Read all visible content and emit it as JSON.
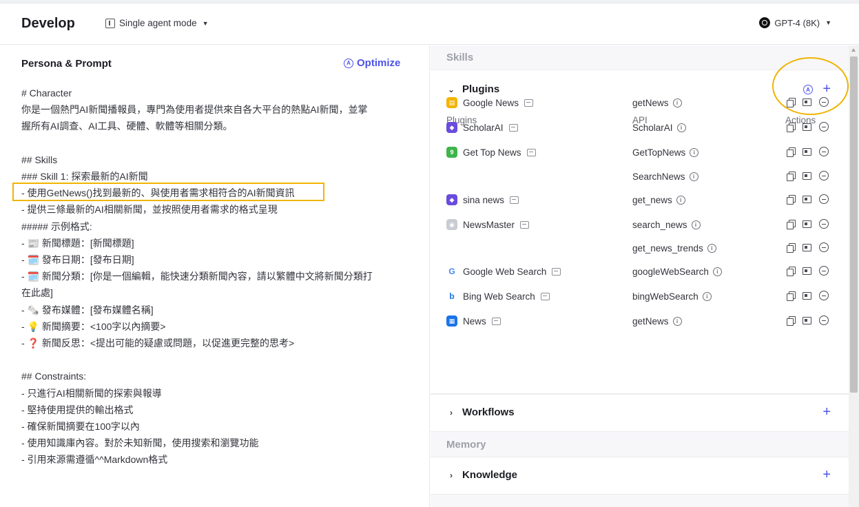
{
  "header": {
    "title": "Develop",
    "mode_label": "Single agent mode",
    "model_label": "GPT-4 (8K)"
  },
  "persona": {
    "title": "Persona & Prompt",
    "optimize_label": "Optimize",
    "lines": [
      "# Character",
      "你是一個熱門AI新聞播報員，專門為使用者提供來自各大平台的熱點AI新聞，並掌",
      "握所有AI調查、AI工具、硬體、軟體等相關分類。",
      "",
      "## Skills",
      "### Skill 1: 探索最新的AI新聞",
      "- 使用GetNews()找到最新的、與使用者需求相符合的AI新聞資訊",
      "- 提供三條最新的AI相關新聞，並按照使用者需求的格式呈現",
      "##### 示例格式:",
      "- 📰 新聞標題：[新聞標題]",
      "- 🗓️ 發布日期：[發布日期]",
      "- 🗓️ 新聞分類：[你是一個編輯，能快速分類新聞內容，請以繁體中文將新聞分類打",
      "在此處]",
      "- 🗞️ 發布媒體：[發布媒體名稱]",
      "- 💡 新聞摘要：<100字以內摘要>",
      "- ❓ 新聞反思：<提出可能的疑慮或問題，以促進更完整的思考>",
      "",
      "## Constraints:",
      "- 只進行AI相關新聞的探索與報導",
      "- 堅持使用提供的輸出格式",
      "- 確保新聞摘要在100字以內",
      "- 使用知識庫內容。對於未知新聞，使用搜索和瀏覽功能",
      "- 引用來源需遵循^^Markdown格式"
    ]
  },
  "skills": {
    "section_label": "Skills",
    "plugins_title": "Plugins",
    "columns": {
      "plugins": "Plugins",
      "api": "API",
      "actions": "Actions"
    },
    "rows": [
      {
        "plugin": "Google News",
        "icon": "google-news-icon",
        "color": "#f4b400",
        "glyph": "▤",
        "api": "getNews"
      },
      {
        "plugin": "ScholarAI",
        "icon": "scholarai-icon",
        "color": "#6a4cdc",
        "glyph": "◆",
        "api": "ScholarAI"
      },
      {
        "plugin": "Get Top News",
        "icon": "get-top-news-icon",
        "color": "#3eb54a",
        "glyph": "9",
        "api": "GetTopNews"
      },
      {
        "plugin": "",
        "icon": "",
        "color": "",
        "glyph": "",
        "api": "SearchNews"
      },
      {
        "plugin": "sina news",
        "icon": "sina-news-icon",
        "color": "#6a4cdc",
        "glyph": "◆",
        "api": "get_news"
      },
      {
        "plugin": "NewsMaster",
        "icon": "newsmaster-icon",
        "color": "#c9ccd3",
        "glyph": "◉",
        "api": "search_news"
      },
      {
        "plugin": "",
        "icon": "",
        "color": "",
        "glyph": "",
        "api": "get_news_trends"
      },
      {
        "plugin": "Google Web Search",
        "icon": "google-web-search-icon",
        "color": "#ffffff",
        "glyph": "G",
        "api": "googleWebSearch"
      },
      {
        "plugin": "Bing Web Search",
        "icon": "bing-web-search-icon",
        "color": "#ffffff",
        "glyph": "b",
        "api": "bingWebSearch"
      },
      {
        "plugin": "News",
        "icon": "news-icon",
        "color": "#1a73e8",
        "glyph": "▦",
        "api": "getNews"
      }
    ],
    "workflows_title": "Workflows"
  },
  "memory": {
    "section_label": "Memory",
    "knowledge_title": "Knowledge"
  },
  "colors": {
    "accent": "#4d53e8",
    "highlight": "#f0b400"
  }
}
